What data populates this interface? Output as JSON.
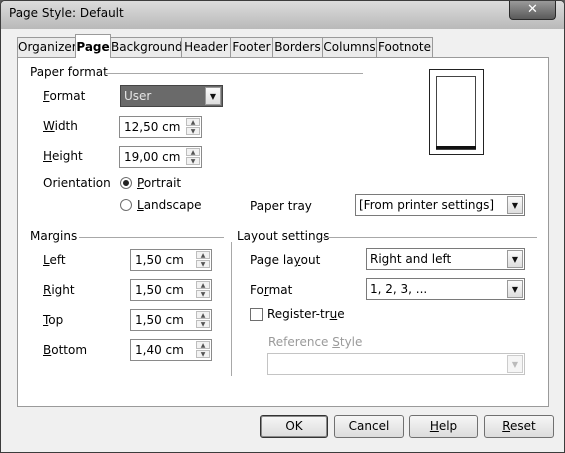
{
  "window": {
    "title": "Page Style: Default",
    "close_glyph": "✕"
  },
  "tabs": [
    {
      "label": "Organizer",
      "active": false
    },
    {
      "label": "Page",
      "active": true
    },
    {
      "label": "Background",
      "active": false
    },
    {
      "label": "Header",
      "active": false
    },
    {
      "label": "Footer",
      "active": false
    },
    {
      "label": "Borders",
      "active": false
    },
    {
      "label": "Columns",
      "active": false
    },
    {
      "label": "Footnote",
      "active": false
    }
  ],
  "paper_format": {
    "section_label": "Paper format",
    "format": {
      "label_mn": "F",
      "label_rest": "ormat",
      "value": "User"
    },
    "width": {
      "label_mn": "W",
      "label_rest": "idth",
      "value": "12,50 cm"
    },
    "height": {
      "label_mn": "H",
      "label_rest": "eight",
      "value": "19,00 cm"
    },
    "orientation": {
      "label": "Orientation",
      "portrait": {
        "label_mn": "P",
        "label_rest": "ortrait",
        "selected": true
      },
      "landscape": {
        "label_mn": "L",
        "label_rest": "andscape",
        "selected": false
      }
    },
    "paper_tray": {
      "label": "Paper tray",
      "value": "[From printer settings]"
    }
  },
  "margins": {
    "section_label": "Margins",
    "left": {
      "label_mn": "L",
      "label_rest": "eft",
      "value": "1,50 cm"
    },
    "right": {
      "label_mn": "R",
      "label_rest": "ight",
      "value": "1,50 cm"
    },
    "top": {
      "label_mn": "T",
      "label_rest": "op",
      "value": "1,50 cm"
    },
    "bottom": {
      "label_mn": "B",
      "label_rest": "ottom",
      "value": "1,40 cm"
    }
  },
  "layout_settings": {
    "section_label": "Layout settings",
    "page_layout": {
      "label_pre": "Page la",
      "label_mn": "y",
      "label_rest": "out",
      "value": "Right and left"
    },
    "format": {
      "label_pre": "Fo",
      "label_mn": "r",
      "label_rest": "mat",
      "value": "1, 2, 3, ..."
    },
    "register_true": {
      "label_pre": "Register-tr",
      "label_mn": "u",
      "label_rest": "e",
      "checked": false
    },
    "reference_style": {
      "label_pre": "Reference ",
      "label_mn": "S",
      "label_rest": "tyle",
      "value": ""
    }
  },
  "buttons": {
    "ok": "OK",
    "cancel": "Cancel",
    "help_mn": "H",
    "help_rest": "elp",
    "reset_mn": "R",
    "reset_rest": "eset"
  },
  "icons": {
    "dropdown": "▼",
    "spin_up": "▲",
    "spin_down": "▼"
  }
}
